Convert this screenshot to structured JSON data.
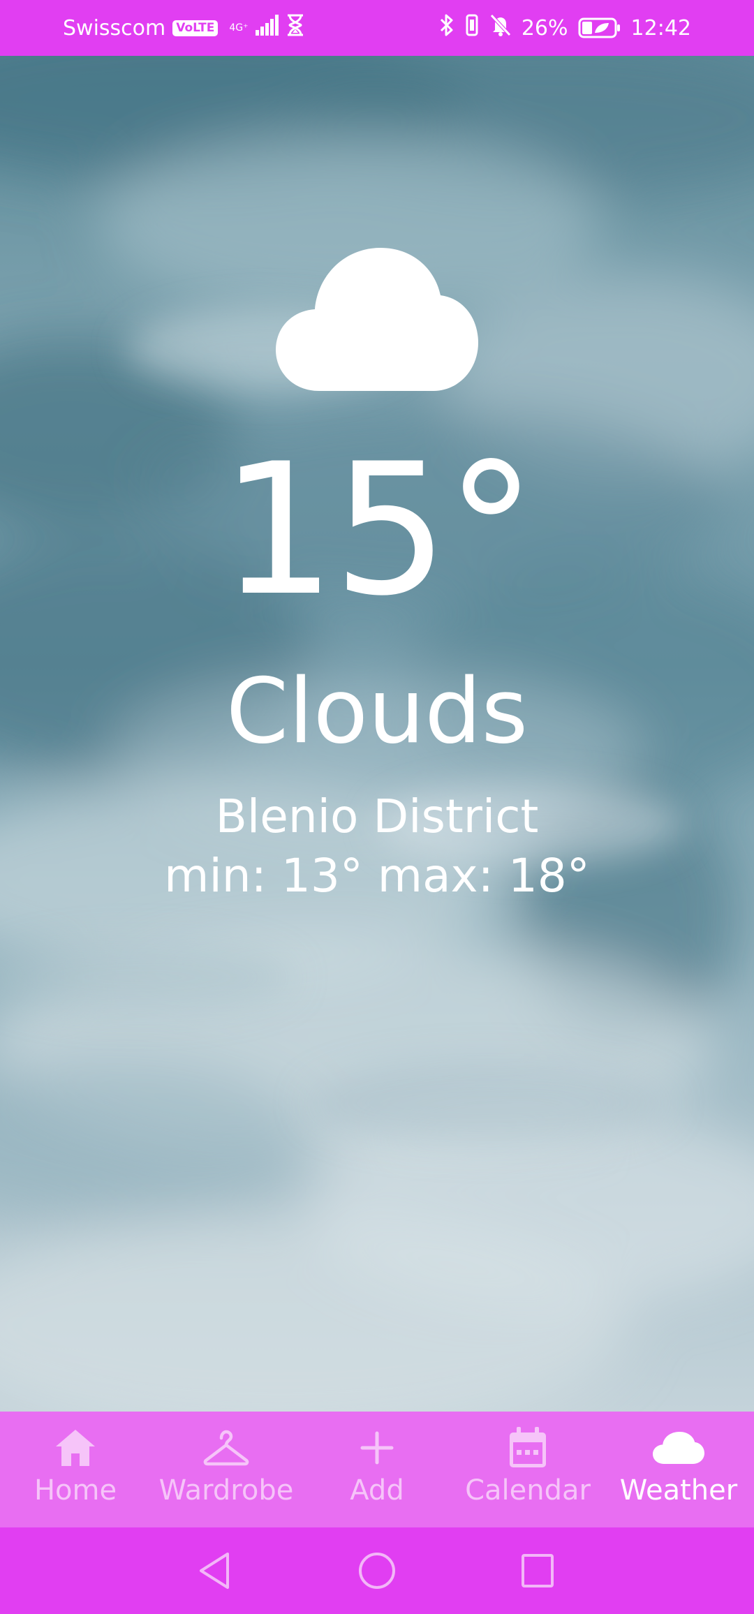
{
  "status_bar": {
    "carrier": "Swisscom",
    "volte": "VoLTE",
    "network": "4G⁺",
    "battery_percent": "26%",
    "time": "12:42",
    "icons": [
      "bluetooth-icon",
      "vibrate-icon",
      "silent-bell-icon",
      "battery-icon"
    ]
  },
  "weather": {
    "icon": "cloud-icon",
    "temperature": "15°",
    "condition": "Clouds",
    "location": "Blenio District",
    "min_max": "min: 13° max: 18°"
  },
  "bottom_nav": {
    "items": [
      {
        "label": "Home",
        "icon": "home-icon",
        "active": false
      },
      {
        "label": "Wardrobe",
        "icon": "hanger-icon",
        "active": false
      },
      {
        "label": "Add",
        "icon": "plus-icon",
        "active": false
      },
      {
        "label": "Calendar",
        "icon": "calendar-icon",
        "active": false
      },
      {
        "label": "Weather",
        "icon": "cloud-icon",
        "active": true
      }
    ]
  },
  "system_nav": {
    "buttons": [
      "back-icon",
      "home-circle-icon",
      "recents-icon"
    ]
  },
  "colors": {
    "status_bar": "#e13ef2",
    "bottom_nav": "#e86ef2",
    "nav_inactive": "#f6c4f9",
    "nav_active": "#ffffff",
    "text": "#ffffff"
  }
}
